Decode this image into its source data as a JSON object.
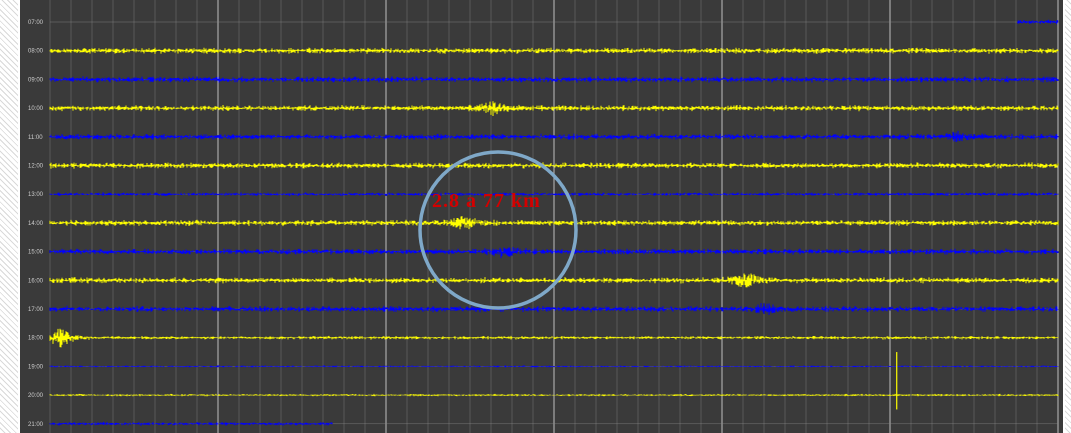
{
  "chart_data": {
    "type": "line",
    "title": "",
    "xlabel": "",
    "ylabel": "",
    "grid": true,
    "colors": {
      "background": "#3a3a3a",
      "grid": "#777777",
      "trace_a": "#ffff00",
      "trace_b": "#0000ff",
      "circle": "#7fa8c8",
      "annotation": "#d40000"
    },
    "rows": [
      {
        "label": "07:00",
        "color": "#0000ff",
        "start": 0.96,
        "end": 1.0,
        "amp": 2
      },
      {
        "label": "08:00",
        "color": "#ffff00",
        "start": 0.0,
        "end": 1.0,
        "amp": 2.5
      },
      {
        "label": "09:00",
        "color": "#0000ff",
        "start": 0.0,
        "end": 1.0,
        "amp": 2.5
      },
      {
        "label": "10:00",
        "color": "#ffff00",
        "start": 0.0,
        "end": 1.0,
        "amp": 2.5
      },
      {
        "label": "11:00",
        "color": "#0000ff",
        "start": 0.0,
        "end": 1.0,
        "amp": 2.5
      },
      {
        "label": "12:00",
        "color": "#ffff00",
        "start": 0.0,
        "end": 1.0,
        "amp": 2.5
      },
      {
        "label": "13:00",
        "color": "#0000ff",
        "start": 0.0,
        "end": 1.0,
        "amp": 1.5
      },
      {
        "label": "14:00",
        "color": "#ffff00",
        "start": 0.0,
        "end": 1.0,
        "amp": 2.5
      },
      {
        "label": "15:00",
        "color": "#0000ff",
        "start": 0.0,
        "end": 1.0,
        "amp": 2.5
      },
      {
        "label": "16:00",
        "color": "#ffff00",
        "start": 0.0,
        "end": 1.0,
        "amp": 2.5
      },
      {
        "label": "17:00",
        "color": "#0000ff",
        "start": 0.0,
        "end": 1.0,
        "amp": 2.5
      },
      {
        "label": "18:00",
        "color": "#ffff00",
        "start": 0.0,
        "end": 1.0,
        "amp": 1.5
      },
      {
        "label": "19:00",
        "color": "#0000ff",
        "start": 0.0,
        "end": 1.0,
        "amp": 0.8
      },
      {
        "label": "20:00",
        "color": "#ffff00",
        "start": 0.0,
        "end": 1.0,
        "amp": 1.0
      },
      {
        "label": "21:00",
        "color": "#0000ff",
        "start": 0.0,
        "end": 0.28,
        "amp": 1.5
      }
    ],
    "events": [
      {
        "row": "14:00",
        "x": 0.41,
        "amp": 7
      },
      {
        "row": "15:00",
        "x": 0.45,
        "amp": 5
      },
      {
        "row": "16:00",
        "x": 0.69,
        "amp": 9
      },
      {
        "row": "18:00",
        "x": 0.01,
        "amp": 10
      },
      {
        "row": "10:00",
        "x": 0.44,
        "amp": 6
      },
      {
        "row": "17:00",
        "x": 0.71,
        "amp": 5
      },
      {
        "row": "11:00",
        "x": 0.9,
        "amp": 5
      }
    ],
    "annotation": "2.8 a 77 km"
  }
}
